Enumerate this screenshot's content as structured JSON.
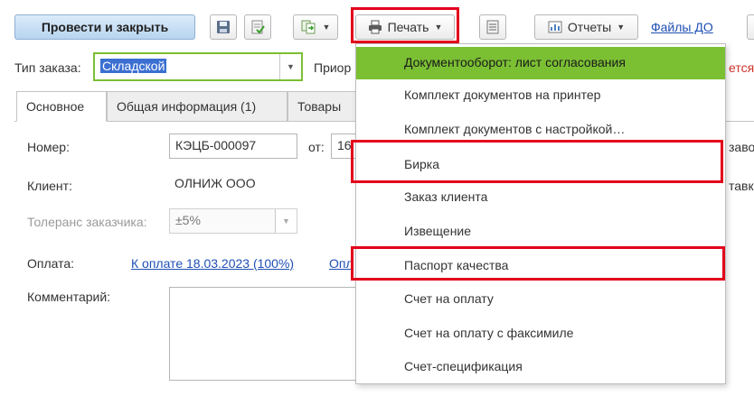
{
  "toolbar": {
    "post_and_close": "Провести и закрыть",
    "print": "Печать",
    "reports": "Отчеты",
    "files_link": "Файлы ДО"
  },
  "header": {
    "order_type_label": "Тип заказа:",
    "order_type_value": "Складской",
    "priority_label": "Приор",
    "right_clipped_text": "ется"
  },
  "tabs": [
    "Основное",
    "Общая информация (1)",
    "Товары"
  ],
  "form": {
    "number_label": "Номер:",
    "number_value": "КЭЦБ-000097",
    "date_label": "от:",
    "date_value": "16",
    "client_label": "Клиент:",
    "client_value": "ОЛНИЖ ООО",
    "tolerance_label": "Толеранс заказчика:",
    "tolerance_value": "±5%",
    "payment_label": "Оплата:",
    "payment_link": "К оплате 18.03.2023 (100%)",
    "payment_link2": "Опл",
    "comment_label": "Комментарий:",
    "right_text_1": "завод",
    "right_text_2": "тавки"
  },
  "print_menu": {
    "items": [
      "Документооборот: лист согласования",
      "Комплект документов на принтер",
      "Комплект документов с настройкой…",
      "Бирка",
      "Заказ клиента",
      "Извещение",
      "Паспорт качества",
      "Счет на оплату",
      "Счет на оплату с факсимиле",
      "Счет-спецификация"
    ],
    "highlighted_index": 0
  },
  "colors": {
    "menu_highlight": "#7bbf33",
    "annotation_box": "#e3001b",
    "link": "#1f4fb5",
    "order_type_border": "#7bbf33"
  }
}
